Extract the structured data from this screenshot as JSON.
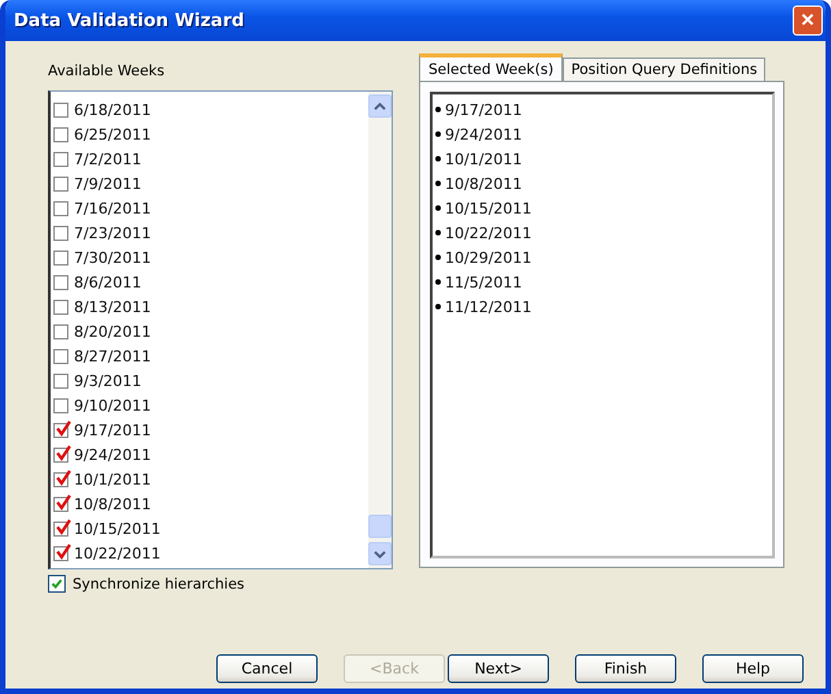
{
  "window": {
    "title": "Data Validation Wizard",
    "close": "✕"
  },
  "available": {
    "label": "Available Weeks",
    "items": [
      {
        "label": "6/18/2011",
        "checked": false
      },
      {
        "label": "6/25/2011",
        "checked": false
      },
      {
        "label": "7/2/2011",
        "checked": false
      },
      {
        "label": "7/9/2011",
        "checked": false
      },
      {
        "label": "7/16/2011",
        "checked": false
      },
      {
        "label": "7/23/2011",
        "checked": false
      },
      {
        "label": "7/30/2011",
        "checked": false
      },
      {
        "label": "8/6/2011",
        "checked": false
      },
      {
        "label": "8/13/2011",
        "checked": false
      },
      {
        "label": "8/20/2011",
        "checked": false
      },
      {
        "label": "8/27/2011",
        "checked": false
      },
      {
        "label": "9/3/2011",
        "checked": false
      },
      {
        "label": "9/10/2011",
        "checked": false
      },
      {
        "label": "9/17/2011",
        "checked": true
      },
      {
        "label": "9/24/2011",
        "checked": true
      },
      {
        "label": "10/1/2011",
        "checked": true
      },
      {
        "label": "10/8/2011",
        "checked": true
      },
      {
        "label": "10/15/2011",
        "checked": true
      },
      {
        "label": "10/22/2011",
        "checked": true
      }
    ]
  },
  "synchronize": {
    "label": "Synchronize hierarchies",
    "checked": true
  },
  "tabs": [
    {
      "label": "Selected Week(s)",
      "selected": true
    },
    {
      "label": "Position Query Definitions",
      "selected": false
    }
  ],
  "selected_weeks": [
    "9/17/2011",
    "9/24/2011",
    "10/1/2011",
    "10/8/2011",
    "10/15/2011",
    "10/22/2011",
    "10/29/2011",
    "11/5/2011",
    "11/12/2011"
  ],
  "buttons": [
    {
      "label": "Cancel",
      "disabled": false
    },
    {
      "label": "<Back",
      "disabled": true
    },
    {
      "label": "Next>",
      "disabled": false
    },
    {
      "label": "Finish",
      "disabled": false
    },
    {
      "label": "Help",
      "disabled": false
    }
  ]
}
